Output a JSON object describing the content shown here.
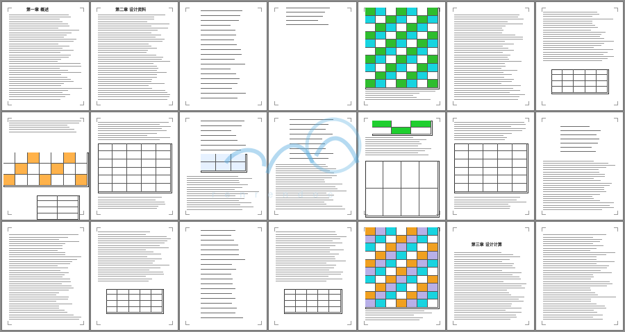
{
  "document": {
    "layout": "thumbnail-grid",
    "columns": 7,
    "rows": 3,
    "accent_colors": {
      "green": "#2ebd2e",
      "cyan": "#17d4e0",
      "orange": "#f0a020",
      "violet": "#b8b0e8",
      "blue_watermark": "#5aaee0"
    },
    "pages": [
      {
        "id": "p1",
        "kind": "text",
        "title": "第一章 概述"
      },
      {
        "id": "p2",
        "kind": "text",
        "title": "第二章 设计资料"
      },
      {
        "id": "p3",
        "kind": "formula"
      },
      {
        "id": "p4",
        "kind": "sparse"
      },
      {
        "id": "p5",
        "kind": "color-table",
        "fills": [
          "#2ebd2e",
          "#17d4e0"
        ]
      },
      {
        "id": "p6",
        "kind": "text"
      },
      {
        "id": "p7",
        "kind": "text-table"
      },
      {
        "id": "p8",
        "kind": "table-sketch"
      },
      {
        "id": "p9",
        "kind": "table"
      },
      {
        "id": "p10",
        "kind": "formula-table"
      },
      {
        "id": "p11",
        "kind": "formula-text"
      },
      {
        "id": "p12",
        "kind": "diagram-table"
      },
      {
        "id": "p13",
        "kind": "table"
      },
      {
        "id": "p14",
        "kind": "diagram-text"
      },
      {
        "id": "p15",
        "kind": "text"
      },
      {
        "id": "p16",
        "kind": "text-table"
      },
      {
        "id": "p17",
        "kind": "formula"
      },
      {
        "id": "p18",
        "kind": "text-table"
      },
      {
        "id": "p19",
        "kind": "color-table",
        "fills": [
          "#f0a020",
          "#b8b0e8",
          "#17d4e0"
        ]
      },
      {
        "id": "p20",
        "kind": "chapter",
        "title": "第三章 设计计算"
      },
      {
        "id": "p21",
        "kind": "text"
      }
    ]
  },
  "watermark": {
    "icon": "wave-logo-icon",
    "text": "r e n r e n d o c"
  }
}
